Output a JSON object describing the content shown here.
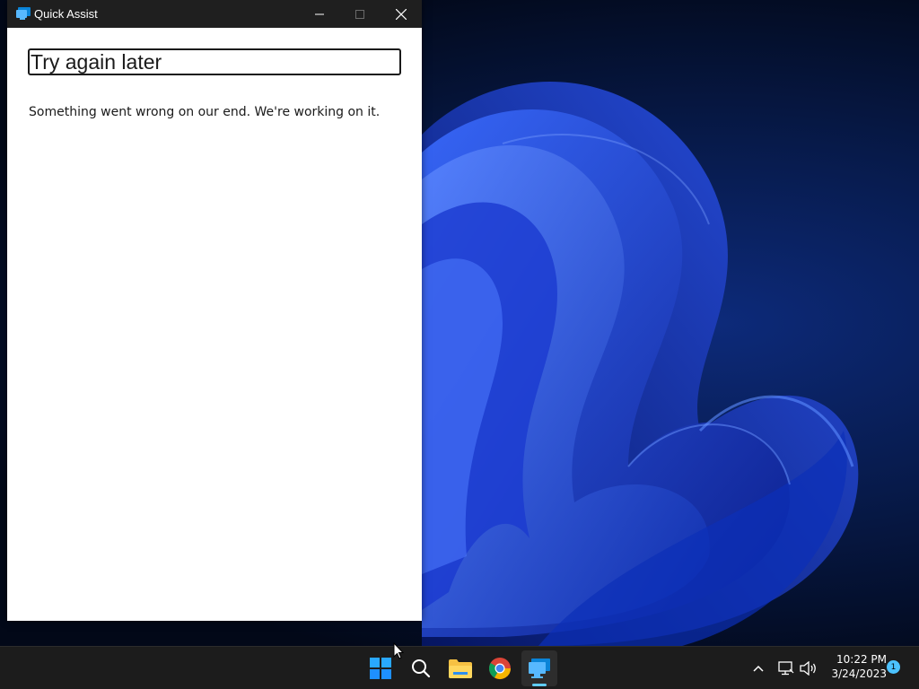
{
  "window": {
    "title": "Quick Assist",
    "app_icon": "quick-assist-icon",
    "controls": [
      "minimize-icon",
      "maximize-icon",
      "close-icon"
    ]
  },
  "content": {
    "heading": "Try again later",
    "message": "Something went wrong on our end. We're working on it."
  },
  "taskbar": {
    "apps": [
      {
        "name": "start",
        "icon": "windows-start-icon"
      },
      {
        "name": "search",
        "icon": "search-icon"
      },
      {
        "name": "file-explorer",
        "icon": "folder-icon"
      },
      {
        "name": "chrome",
        "icon": "chrome-icon"
      },
      {
        "name": "quick-assist",
        "icon": "quick-assist-icon",
        "active": true
      }
    ],
    "tray": {
      "icons": [
        "chevron-up-icon",
        "network-icon",
        "volume-icon"
      ],
      "time": "10:22 PM",
      "date": "3/24/2023",
      "notification_count": "1"
    }
  },
  "colors": {
    "titlebar": "#1f1f1f",
    "taskbar": "#1c1c1c",
    "accent": "#60cdff",
    "desktop": "#071a4a"
  }
}
